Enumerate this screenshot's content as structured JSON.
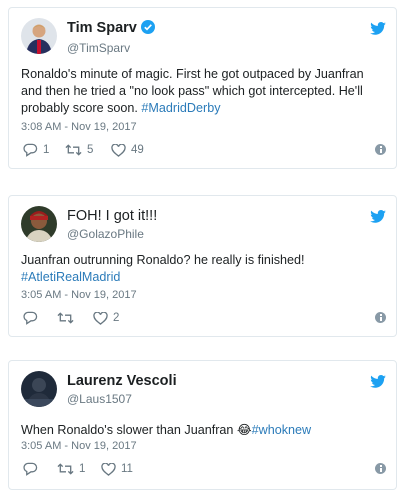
{
  "tweets": [
    {
      "display_name": "Tim Sparv",
      "handle": "@TimSparv",
      "verified": true,
      "text_lines": [
        "Ronaldo's minute of magic. First he got outpaced by Juanfran",
        "and then he tried a \"no look pass\" which got intercepted. He'll",
        "probably score soon. "
      ],
      "hashtag": "#MadridDerby",
      "timestamp": "3:08 AM - Nov 19, 2017",
      "replies": "1",
      "retweets": "5",
      "likes": "49"
    },
    {
      "display_name": "FOH! I got it!!!",
      "handle": "@GolazoPhile",
      "verified": false,
      "text_line": "Juanfran outrunning Ronaldo? he really is finished!",
      "hashtag": "#AtletiRealMadrid",
      "timestamp": "3:05 AM - Nov 19, 2017",
      "replies": "",
      "retweets": "",
      "likes": "2"
    },
    {
      "display_name": "Laurenz Vescoli",
      "handle": "@Laus1507",
      "verified": false,
      "text": "When Ronaldo's slower than Juanfran ",
      "emoji": "😂",
      "hashtag": "#whoknew",
      "timestamp": "3:05 AM - Nov 19, 2017",
      "replies": "",
      "retweets": "1",
      "likes": "11"
    }
  ],
  "colors": {
    "link": "#2b7bb9",
    "twitter_blue": "#1da1f2",
    "muted": "#697882",
    "border": "#e1e8ed"
  },
  "icons": [
    "twitter-bird-icon",
    "verified-badge-icon",
    "reply-icon",
    "retweet-icon",
    "like-heart-icon",
    "info-icon"
  ]
}
